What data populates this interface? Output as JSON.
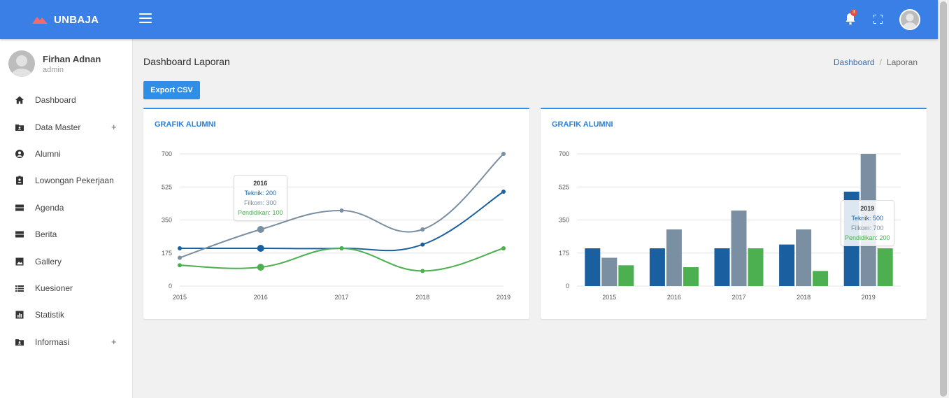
{
  "brand": {
    "name": "UNBAJA"
  },
  "notifications": {
    "count": "3"
  },
  "user": {
    "name": "Firhan Adnan",
    "role": "admin"
  },
  "sidebar": {
    "items": [
      {
        "label": "Dashboard",
        "icon": "home-icon",
        "expandable": false
      },
      {
        "label": "Data Master",
        "icon": "folder-user-icon",
        "expandable": true
      },
      {
        "label": "Alumni",
        "icon": "user-circle-icon",
        "expandable": false
      },
      {
        "label": "Lowongan Pekerjaan",
        "icon": "badge-icon",
        "expandable": false
      },
      {
        "label": "Agenda",
        "icon": "server-icon",
        "expandable": false
      },
      {
        "label": "Berita",
        "icon": "server-icon",
        "expandable": false
      },
      {
        "label": "Gallery",
        "icon": "image-icon",
        "expandable": false
      },
      {
        "label": "Kuesioner",
        "icon": "list-icon",
        "expandable": false
      },
      {
        "label": "Statistik",
        "icon": "bar-chart-icon",
        "expandable": false
      },
      {
        "label": "Informasi",
        "icon": "folder-user-icon",
        "expandable": true
      }
    ],
    "plus": "+"
  },
  "page": {
    "title": "Dashboard Laporan"
  },
  "breadcrumb": {
    "link": "Dashboard",
    "separator": "/",
    "current": "Laporan"
  },
  "actions": {
    "export_label": "Export CSV"
  },
  "colors": {
    "teknik": "#1a5fa0",
    "filkom": "#7b8fa2",
    "pendidikan": "#4caf50",
    "accent": "#2f8fe6",
    "topbar": "#3a7fe6"
  },
  "chart_data": [
    {
      "type": "line",
      "title": "GRAFIK ALUMNI",
      "x": [
        "2015",
        "2016",
        "2017",
        "2018",
        "2019"
      ],
      "series": [
        {
          "name": "Teknik",
          "values": [
            200,
            200,
            200,
            220,
            500
          ]
        },
        {
          "name": "Filkom",
          "values": [
            150,
            300,
            400,
            300,
            700
          ]
        },
        {
          "name": "Pendidikan",
          "values": [
            110,
            100,
            200,
            80,
            200
          ]
        }
      ],
      "ylim": [
        0,
        700
      ],
      "yticks": [
        "0",
        "175",
        "350",
        "525",
        "700"
      ],
      "grid": true,
      "tooltip": {
        "title": "2016",
        "lines": [
          "Teknik: 200",
          "Filkom: 300",
          "Pendidikan: 100"
        ]
      }
    },
    {
      "type": "bar",
      "title": "GRAFIK ALUMNI",
      "categories": [
        "2015",
        "2016",
        "2017",
        "2018",
        "2019"
      ],
      "series": [
        {
          "name": "Teknik",
          "values": [
            200,
            200,
            200,
            220,
            500
          ]
        },
        {
          "name": "Filkom",
          "values": [
            150,
            300,
            400,
            300,
            700
          ]
        },
        {
          "name": "Pendidikan",
          "values": [
            110,
            100,
            200,
            80,
            200
          ]
        }
      ],
      "ylim": [
        0,
        700
      ],
      "yticks": [
        "0",
        "175",
        "350",
        "525",
        "700"
      ],
      "grid": true,
      "tooltip": {
        "title": "2019",
        "lines": [
          "Teknik: 500",
          "Filkom: 700",
          "Pendidikan: 200"
        ]
      }
    }
  ]
}
